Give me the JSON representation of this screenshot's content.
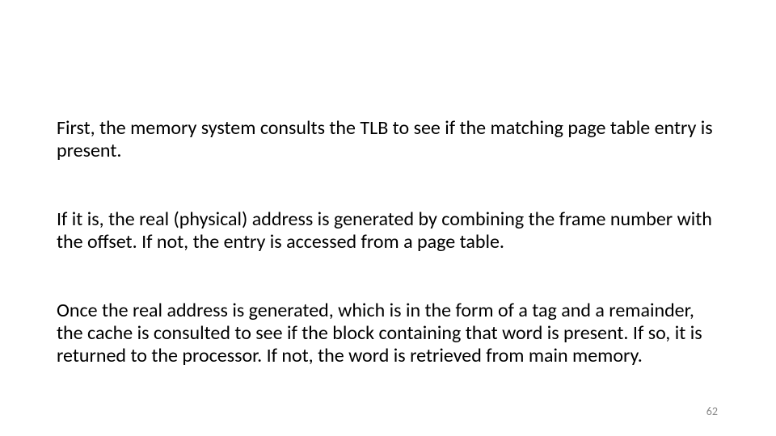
{
  "paragraphs": {
    "p1": "First, the memory system consults the TLB to see if the matching page table entry is present.",
    "p2": "If it is, the real (physical) address is generated by combining the frame number with the offset. If not, the entry is accessed from a page table.",
    "p3": "Once the real address is generated, which is in the form of a tag and a remainder, the cache is consulted to see if the block containing that word is present. If so, it is returned to the processor. If not, the word is retrieved from main memory."
  },
  "page_number": "62"
}
